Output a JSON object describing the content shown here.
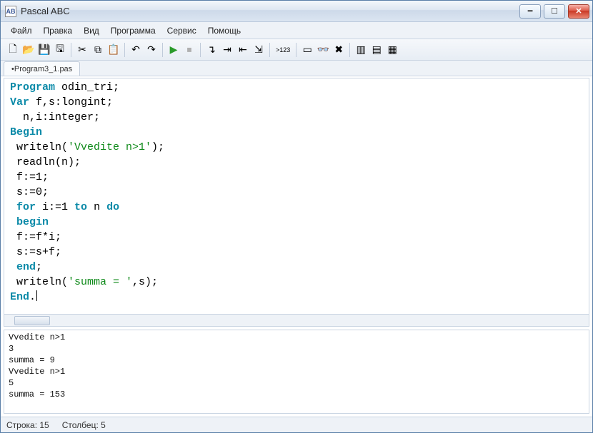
{
  "app": {
    "title": "Pascal ABC"
  },
  "menu": {
    "items": [
      "Файл",
      "Правка",
      "Вид",
      "Программа",
      "Сервис",
      "Помощь"
    ]
  },
  "toolbar": {
    "groups": [
      {
        "buttons": [
          {
            "name": "new-file-icon",
            "glyph": "🗋"
          },
          {
            "name": "open-file-icon",
            "glyph": "📂"
          },
          {
            "name": "save-icon",
            "glyph": "💾"
          },
          {
            "name": "save-all-icon",
            "glyph": "🖫"
          }
        ]
      },
      {
        "buttons": [
          {
            "name": "cut-icon",
            "glyph": "✂"
          },
          {
            "name": "copy-icon",
            "glyph": "⧉"
          },
          {
            "name": "paste-icon",
            "glyph": "📋"
          }
        ]
      },
      {
        "buttons": [
          {
            "name": "undo-icon",
            "glyph": "↶"
          },
          {
            "name": "redo-icon",
            "glyph": "↷"
          }
        ]
      },
      {
        "buttons": [
          {
            "name": "run-icon",
            "glyph": "▶",
            "color": "#2a9a2a"
          },
          {
            "name": "stop-icon",
            "glyph": "⏹",
            "color": "#b0b0b0"
          }
        ]
      },
      {
        "buttons": [
          {
            "name": "step-into-icon",
            "glyph": "↴"
          },
          {
            "name": "step-over-icon",
            "glyph": "⇥"
          },
          {
            "name": "step-out-icon",
            "glyph": "⇤"
          },
          {
            "name": "run-to-cursor-icon",
            "glyph": "⇲"
          }
        ]
      },
      {
        "buttons": [
          {
            "name": "breakpoint-icon",
            "glyph": ">123"
          }
        ]
      },
      {
        "buttons": [
          {
            "name": "window-icon",
            "glyph": "▭"
          },
          {
            "name": "glasses-icon",
            "glyph": "👓"
          },
          {
            "name": "delete-icon",
            "glyph": "✖"
          }
        ]
      },
      {
        "buttons": [
          {
            "name": "panel-1-icon",
            "glyph": "▥"
          },
          {
            "name": "panel-2-icon",
            "glyph": "▤"
          },
          {
            "name": "panel-3-icon",
            "glyph": "▦"
          }
        ]
      }
    ]
  },
  "tabs": [
    {
      "label": "•Program3_1.pas",
      "active": true
    }
  ],
  "code": {
    "lines": [
      {
        "tokens": [
          {
            "t": "kw",
            "v": "Program"
          },
          {
            "t": "",
            "v": " odin_tri;"
          }
        ]
      },
      {
        "tokens": [
          {
            "t": "kw",
            "v": "Var"
          },
          {
            "t": "",
            "v": " f,s:longint;"
          }
        ]
      },
      {
        "tokens": [
          {
            "t": "",
            "v": "  n,i:integer;"
          }
        ]
      },
      {
        "tokens": [
          {
            "t": "kw",
            "v": "Begin"
          }
        ]
      },
      {
        "tokens": [
          {
            "t": "",
            "v": " writeln("
          },
          {
            "t": "str",
            "v": "'Vvedite n>1'"
          },
          {
            "t": "",
            "v": ");"
          }
        ]
      },
      {
        "tokens": [
          {
            "t": "",
            "v": " readln(n);"
          }
        ]
      },
      {
        "tokens": [
          {
            "t": "",
            "v": " f:=1;"
          }
        ]
      },
      {
        "tokens": [
          {
            "t": "",
            "v": " s:=0;"
          }
        ]
      },
      {
        "tokens": [
          {
            "t": "",
            "v": " "
          },
          {
            "t": "kw",
            "v": "for"
          },
          {
            "t": "",
            "v": " i:=1 "
          },
          {
            "t": "kw",
            "v": "to"
          },
          {
            "t": "",
            "v": " n "
          },
          {
            "t": "kw",
            "v": "do"
          }
        ]
      },
      {
        "tokens": [
          {
            "t": "",
            "v": " "
          },
          {
            "t": "kw",
            "v": "begin"
          }
        ]
      },
      {
        "tokens": [
          {
            "t": "",
            "v": " f:=f*i;"
          }
        ]
      },
      {
        "tokens": [
          {
            "t": "",
            "v": " s:=s+f;"
          }
        ]
      },
      {
        "tokens": [
          {
            "t": "",
            "v": " "
          },
          {
            "t": "kw",
            "v": "end"
          },
          {
            "t": "",
            "v": ";"
          }
        ]
      },
      {
        "tokens": [
          {
            "t": "",
            "v": " writeln("
          },
          {
            "t": "str",
            "v": "'summa = '"
          },
          {
            "t": "",
            "v": ",s);"
          }
        ]
      },
      {
        "tokens": [
          {
            "t": "kw",
            "v": "End"
          },
          {
            "t": "",
            "v": "."
          }
        ],
        "cursor": true
      }
    ]
  },
  "output": {
    "lines": [
      "Vvedite n>1",
      "3",
      "summa = 9",
      "Vvedite n>1",
      "5",
      "summa = 153"
    ]
  },
  "status": {
    "line_label": "Строка:",
    "line_value": "15",
    "col_label": "Столбец:",
    "col_value": "5"
  }
}
